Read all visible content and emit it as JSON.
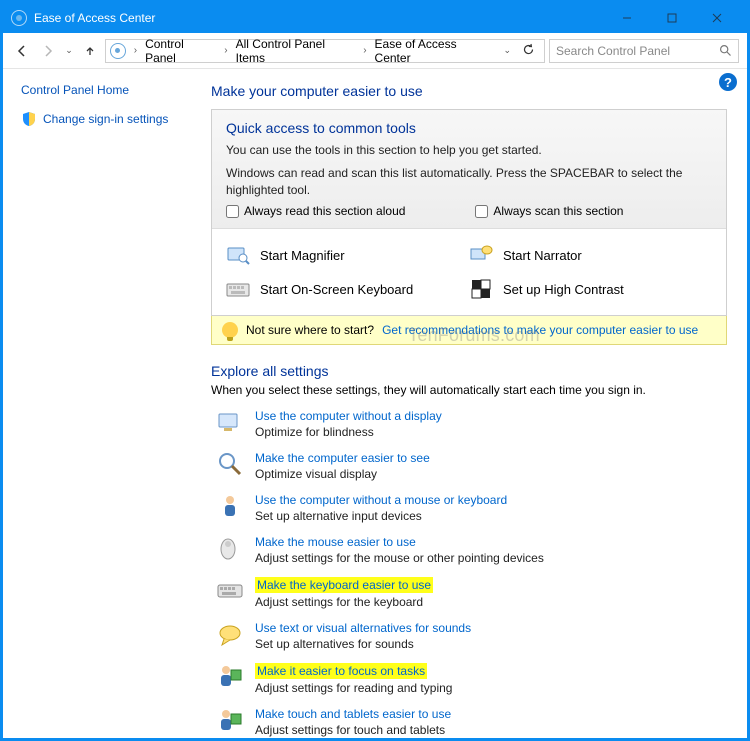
{
  "window": {
    "title": "Ease of Access Center"
  },
  "breadcrumb": {
    "items": [
      "Control Panel",
      "All Control Panel Items",
      "Ease of Access Center"
    ]
  },
  "search": {
    "placeholder": "Search Control Panel"
  },
  "sidebar": {
    "home": "Control Panel Home",
    "signin": "Change sign-in settings"
  },
  "heading": "Make your computer easier to use",
  "quick": {
    "title": "Quick access to common tools",
    "line1": "You can use the tools in this section to help you get started.",
    "line2": "Windows can read and scan this list automatically.  Press the SPACEBAR to select the highlighted tool.",
    "check1": "Always read this section aloud",
    "check2": "Always scan this section",
    "tools": {
      "magnifier": "Start Magnifier",
      "narrator": "Start Narrator",
      "osk": "Start On-Screen Keyboard",
      "contrast": "Set up High Contrast"
    }
  },
  "hint": {
    "prefix": "Not sure where to start?",
    "link": "Get recommendations to make your computer easier to use"
  },
  "explore": {
    "title": "Explore all settings",
    "sub": "When you select these settings, they will automatically start each time you sign in.",
    "items": [
      {
        "link": "Use the computer without a display",
        "desc": "Optimize for blindness",
        "hl": false
      },
      {
        "link": "Make the computer easier to see",
        "desc": "Optimize visual display",
        "hl": false
      },
      {
        "link": "Use the computer without a mouse or keyboard",
        "desc": "Set up alternative input devices",
        "hl": false
      },
      {
        "link": "Make the mouse easier to use",
        "desc": "Adjust settings for the mouse or other pointing devices",
        "hl": false
      },
      {
        "link": "Make the keyboard easier to use",
        "desc": "Adjust settings for the keyboard",
        "hl": true
      },
      {
        "link": "Use text or visual alternatives for sounds",
        "desc": "Set up alternatives for sounds",
        "hl": false
      },
      {
        "link": "Make it easier to focus on tasks",
        "desc": "Adjust settings for reading and typing",
        "hl": true
      },
      {
        "link": "Make touch and tablets easier to use",
        "desc": "Adjust settings for touch and tablets",
        "hl": false
      }
    ]
  },
  "watermark": "TenForums.com"
}
